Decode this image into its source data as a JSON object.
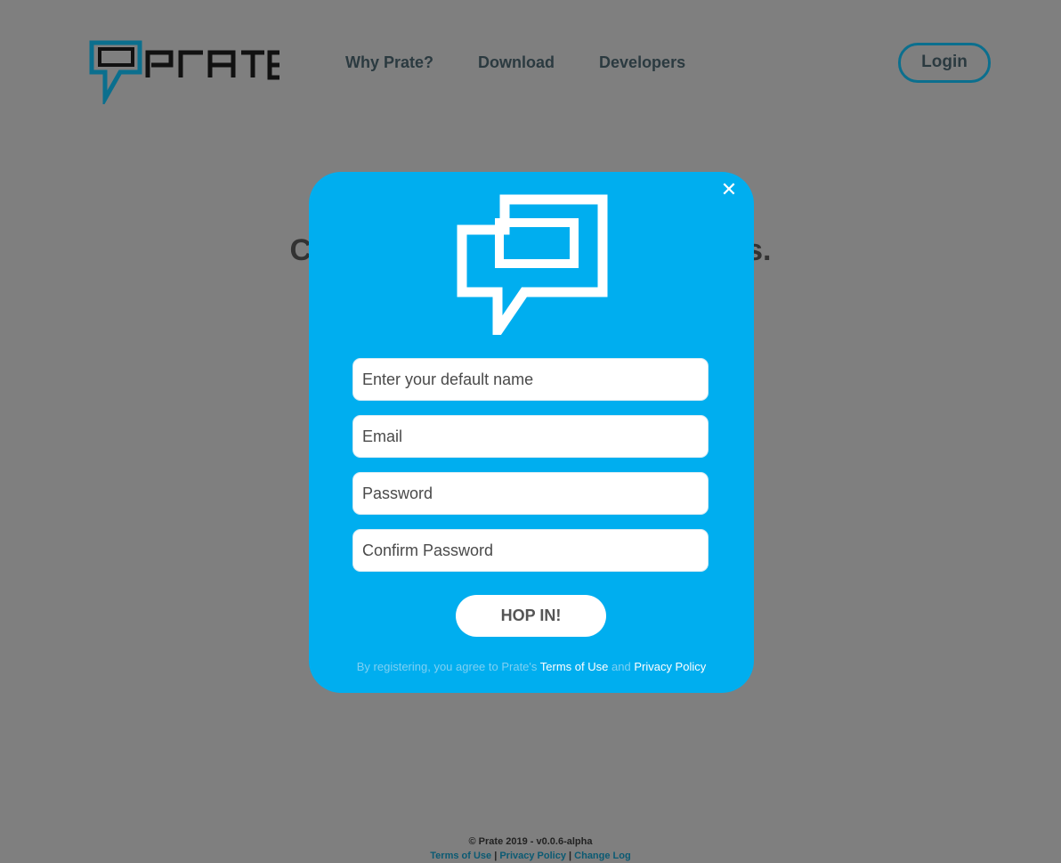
{
  "brand": {
    "name": "Prate",
    "accent": "#00aeef",
    "outline": "#0b6f8e"
  },
  "nav": {
    "items": [
      {
        "label": "Why Prate?"
      },
      {
        "label": "Download"
      },
      {
        "label": "Developers"
      }
    ],
    "login_label": "Login"
  },
  "hero": {
    "left_text": "Ch",
    "right_text": "ts."
  },
  "modal": {
    "close_icon": "close-icon",
    "fields": {
      "name_placeholder": "Enter your default name",
      "email_placeholder": "Email",
      "password_placeholder": "Password",
      "confirm_placeholder": "Confirm Password"
    },
    "submit_label": "HOP IN!",
    "agree_prefix": "By registering, you agree to Prate's",
    "agree_terms": "Terms of Use",
    "agree_and": "and",
    "agree_privacy": "Privacy Policy"
  },
  "footer": {
    "copyright": "© Prate 2019 - v0.0.6-alpha",
    "links": [
      {
        "label": "Terms of Use"
      },
      {
        "label": "Privacy Policy"
      },
      {
        "label": "Change Log"
      }
    ],
    "separator": "|"
  }
}
